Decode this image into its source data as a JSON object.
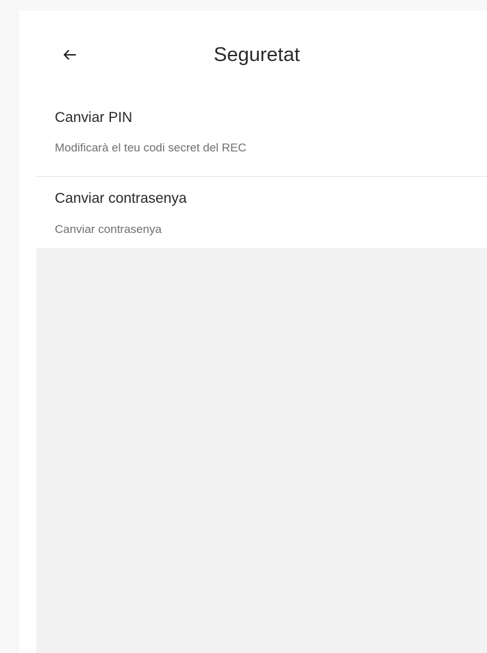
{
  "header": {
    "back_icon": "arrow-left-icon",
    "title": "Seguretat"
  },
  "security_options": [
    {
      "title": "Canviar PIN",
      "subtitle": "Modificarà el teu codi secret del REC"
    },
    {
      "title": "Canviar contrasenya",
      "subtitle": "Canviar contrasenya"
    }
  ],
  "colors": {
    "background": "#f8f8f8",
    "surface": "#ffffff",
    "title_text": "#2b2b2b",
    "secondary_text": "#6f6f6f",
    "divider": "#e5e5e5",
    "empty_area": "#f2f2f2"
  }
}
